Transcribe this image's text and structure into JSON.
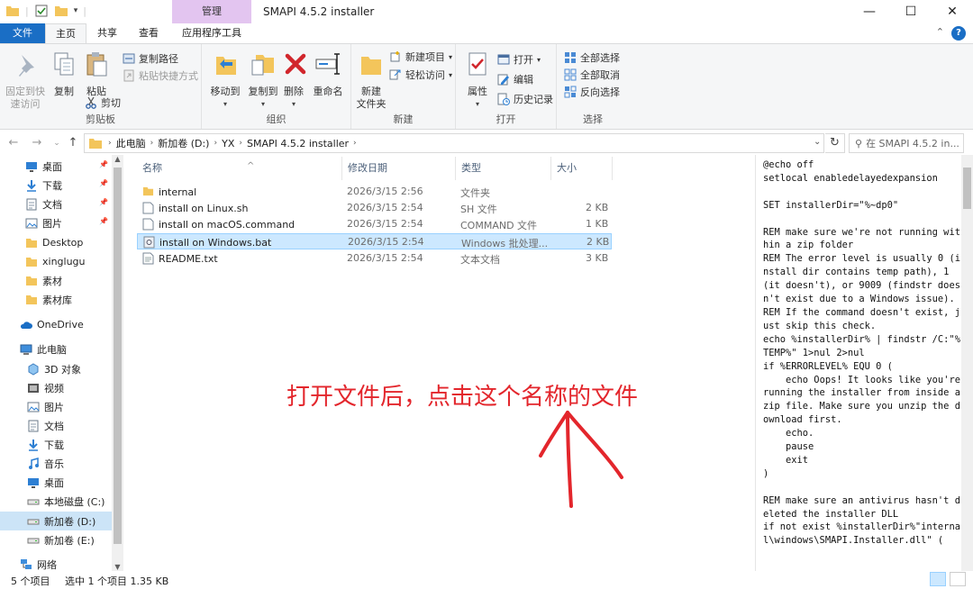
{
  "window": {
    "title": "SMAPI 4.5.2 installer",
    "context_tab": "管理",
    "minimize": "—",
    "maximize": "☐",
    "close": "✕"
  },
  "ribbon_tabs": {
    "file": "文件",
    "home": "主页",
    "share": "共享",
    "view": "查看",
    "app_tools": "应用程序工具",
    "collapse": "⌃"
  },
  "ribbon": {
    "clipboard": {
      "label": "剪贴板",
      "pin": "固定到快\n速访问",
      "copy": "复制",
      "paste": "粘贴",
      "copy_path": "复制路径",
      "paste_shortcut": "粘贴快捷方式",
      "cut": "剪切"
    },
    "organize": {
      "label": "组织",
      "move_to": "移动到",
      "copy_to": "复制到",
      "delete": "删除",
      "rename": "重命名"
    },
    "new": {
      "label": "新建",
      "new_folder": "新建\n文件夹",
      "new_item": "新建项目",
      "easy_access": "轻松访问"
    },
    "open": {
      "label": "打开",
      "properties": "属性",
      "open": "打开",
      "edit": "编辑",
      "history": "历史记录"
    },
    "select": {
      "label": "选择",
      "select_all": "全部选择",
      "select_none": "全部取消",
      "invert": "反向选择"
    }
  },
  "address": {
    "crumbs": [
      "此电脑",
      "新加卷 (D:)",
      "YX",
      "SMAPI 4.5.2 installer"
    ],
    "search_placeholder": "在 SMAPI 4.5.2 in..."
  },
  "nav_pane": {
    "items": [
      {
        "label": "桌面",
        "icon": "desktop-icon",
        "pinned": true
      },
      {
        "label": "下载",
        "icon": "download-icon",
        "pinned": true
      },
      {
        "label": "文档",
        "icon": "document-icon",
        "pinned": true
      },
      {
        "label": "图片",
        "icon": "picture-icon",
        "pinned": true
      },
      {
        "label": "Desktop",
        "icon": "folder-icon",
        "pinned": false
      },
      {
        "label": "xinglugu",
        "icon": "folder-icon",
        "pinned": false
      },
      {
        "label": "素材",
        "icon": "folder-icon",
        "pinned": false
      },
      {
        "label": "素材库",
        "icon": "folder-icon",
        "pinned": false
      },
      {
        "label": "OneDrive",
        "icon": "cloud-icon",
        "pinned": false
      },
      {
        "label": "此电脑",
        "icon": "computer-icon",
        "pinned": false
      },
      {
        "label": "3D 对象",
        "icon": "cube-icon",
        "pinned": false
      },
      {
        "label": "视频",
        "icon": "video-icon",
        "pinned": false
      },
      {
        "label": "图片",
        "icon": "picture-icon",
        "pinned": false
      },
      {
        "label": "文档",
        "icon": "document-icon",
        "pinned": false
      },
      {
        "label": "下载",
        "icon": "download-icon",
        "pinned": false
      },
      {
        "label": "音乐",
        "icon": "music-icon",
        "pinned": false
      },
      {
        "label": "桌面",
        "icon": "desktop-icon",
        "pinned": false
      },
      {
        "label": "本地磁盘 (C:)",
        "icon": "drive-icon",
        "pinned": false
      },
      {
        "label": "新加卷 (D:)",
        "icon": "drive-icon",
        "pinned": false,
        "selected": true
      },
      {
        "label": "新加卷 (E:)",
        "icon": "drive-icon",
        "pinned": false
      },
      {
        "label": "网络",
        "icon": "network-icon",
        "pinned": false
      }
    ]
  },
  "file_list": {
    "columns": {
      "name": "名称",
      "date": "修改日期",
      "type": "类型",
      "size": "大小"
    },
    "rows": [
      {
        "name": "internal",
        "date": "2026/3/15 2:56",
        "type": "文件夹",
        "size": "",
        "icon": "folder-icon"
      },
      {
        "name": "install on Linux.sh",
        "date": "2026/3/15 2:54",
        "type": "SH 文件",
        "size": "2 KB",
        "icon": "file-icon"
      },
      {
        "name": "install on macOS.command",
        "date": "2026/3/15 2:54",
        "type": "COMMAND 文件",
        "size": "1 KB",
        "icon": "file-icon"
      },
      {
        "name": "install on Windows.bat",
        "date": "2026/3/15 2:54",
        "type": "Windows 批处理...",
        "size": "2 KB",
        "icon": "batch-file-icon",
        "selected": true
      },
      {
        "name": "README.txt",
        "date": "2026/3/15 2:54",
        "type": "文本文档",
        "size": "3 KB",
        "icon": "text-file-icon"
      }
    ]
  },
  "annotation": "打开文件后，点击这个名称的文件",
  "preview_text": "@echo off\nsetlocal enabledelayedexpansion\n\nSET installerDir=\"%~dp0\"\n\nREM make sure we're not running within a zip folder\nREM The error level is usually 0 (install dir contains temp path), 1 (it doesn't), or 9009 (findstr doesn't exist due to a Windows issue).\nREM If the command doesn't exist, just skip this check.\necho %installerDir% | findstr /C:\"%TEMP%\" 1>nul 2>nul\nif %ERRORLEVEL% EQU 0 (\n    echo Oops! It looks like you're running the installer from inside a zip file. Make sure you unzip the download first.\n    echo.\n    pause\n    exit\n)\n\nREM make sure an antivirus hasn't deleted the installer DLL\nif not exist %installerDir%\"internal\\windows\\SMAPI.Installer.dll\" (",
  "status": {
    "count": "5 个项目",
    "selected": "选中 1 个项目  1.35 KB"
  },
  "colors": {
    "accent": "#1a6ec5",
    "context_tab": "#e3c5f0",
    "selection": "#cce8ff",
    "annotation": "#e3262c"
  }
}
